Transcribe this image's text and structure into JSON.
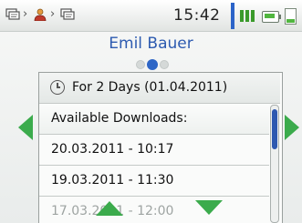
{
  "status_bar": {
    "breadcrumb": [
      {
        "icon": "device-list-icon"
      },
      {
        "icon": "user-icon"
      },
      {
        "icon": "device-list-icon"
      }
    ],
    "separator": "›",
    "time": "15:42",
    "signal_icon": "signal-strength-icon",
    "battery_icon": "battery-icon",
    "memory_icon": "memory-card-icon",
    "divider_color": "#2b63c8"
  },
  "header": {
    "title": "Emil Bauer",
    "page_indicator": {
      "count": 3,
      "active_index": 1
    }
  },
  "panel": {
    "period_label": "For 2 Days (01.04.2011)",
    "section_label": "Available Downloads:",
    "items": [
      "20.03.2011 - 10:17",
      "19.03.2011 - 11:30",
      "17.03.2011 - 12:00"
    ],
    "scroll_position": 0.0
  },
  "colors": {
    "accent": "#2d5bb0",
    "arrows": "#3bab4c"
  }
}
